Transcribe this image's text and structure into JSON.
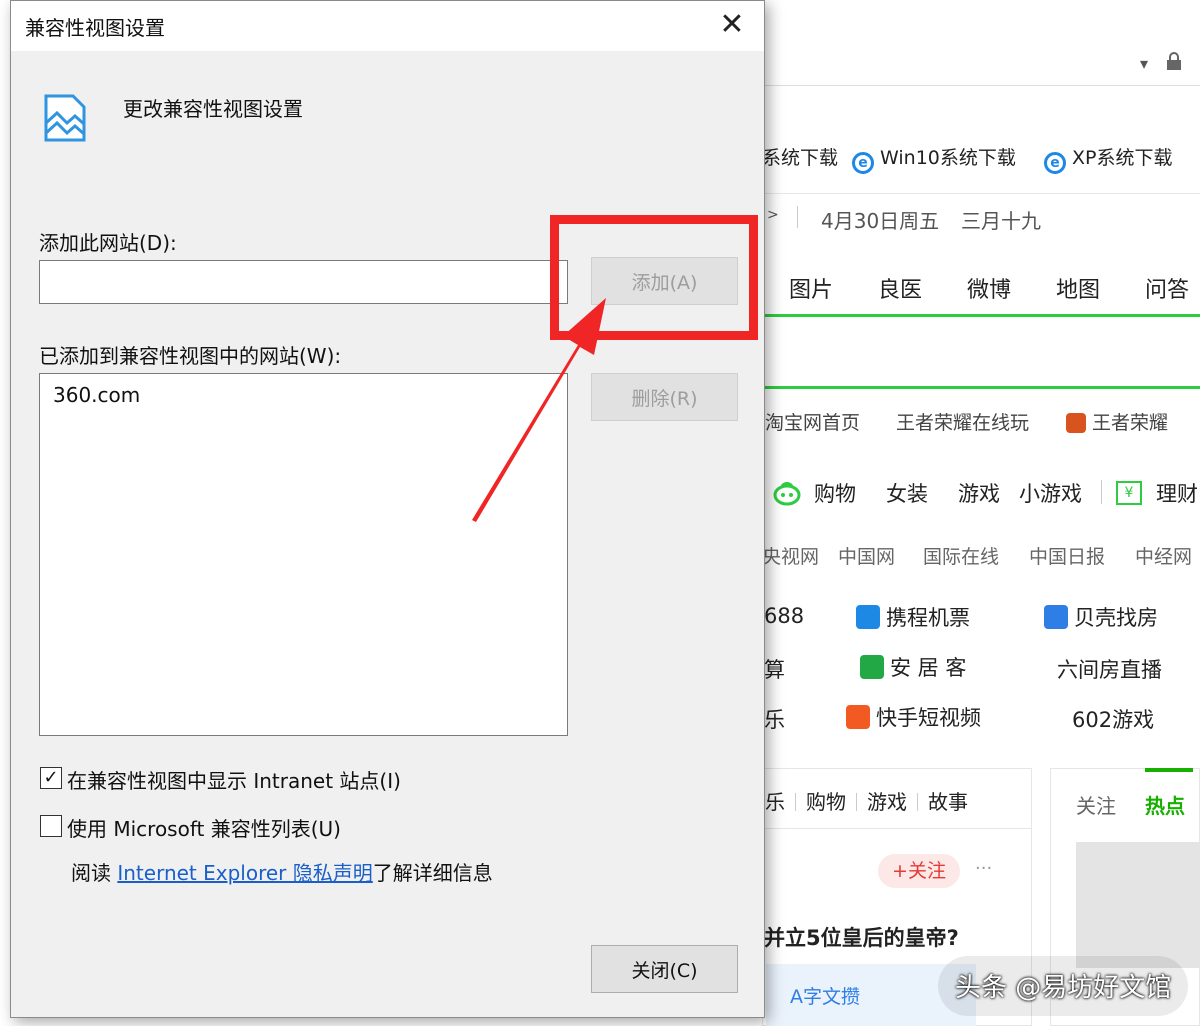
{
  "browser": {
    "favorites": [
      {
        "label": "系统下载",
        "icon": "ie-page-icon"
      },
      {
        "label": "Win10系统下载",
        "icon": "ie-page-icon"
      },
      {
        "label": "XP系统下载",
        "icon": "ie-page-icon"
      }
    ],
    "date": "4月30日周五",
    "lunar": "三月十九",
    "nav_tabs": [
      "图片",
      "良医",
      "微博",
      "地图",
      "问答"
    ],
    "quick_links": [
      "淘宝网首页",
      "王者荣耀在线玩",
      "王者荣耀"
    ],
    "categories": [
      "购物",
      "女装",
      "游戏",
      "小游戏",
      "理财"
    ],
    "news_sites": [
      "央视网",
      "中国网",
      "国际在线",
      "中国日报",
      "中经网"
    ],
    "sites_col1": [
      "688",
      "算",
      "乐"
    ],
    "sites_col2": [
      "携程机票",
      "安 居 客",
      "快手短视频"
    ],
    "sites_col3": [
      "贝壳找房",
      "六间房直播",
      "602游戏"
    ],
    "feed_tabs": [
      "乐",
      "购物",
      "游戏",
      "故事"
    ],
    "follow_label": "+关注",
    "more_label": "···",
    "headline": "并立5位皇后的皇帝?",
    "source_label": "A字文攒",
    "right_tabs": [
      "关注",
      "热点"
    ]
  },
  "dialog": {
    "title": "兼容性视图设置",
    "close_symbol": "✕",
    "header": "更改兼容性视图设置",
    "add_label": "添加此网站(D):",
    "add_input_value": "",
    "add_button": "添加(A)",
    "list_label": "已添加到兼容性视图中的网站(W):",
    "sites": [
      "360.com"
    ],
    "remove_button": "删除(R)",
    "checkbox_intranet": "在兼容性视图中显示 Intranet 站点(I)",
    "checkbox_intranet_checked": true,
    "checkbox_mslist": "使用 Microsoft 兼容性列表(U)",
    "checkbox_mslist_checked": false,
    "info_prefix": "阅读",
    "info_link": "Internet Explorer 隐私声明",
    "info_suffix": "了解详细信息",
    "close_button": "关闭(C)"
  },
  "annotation": {
    "highlight_color": "#f02525"
  },
  "watermark": {
    "text": "头条 @易坊好文馆"
  },
  "colors": {
    "accent_green": "#2ecc40",
    "link_blue": "#1a5fc9",
    "hot_green": "#18b000"
  }
}
